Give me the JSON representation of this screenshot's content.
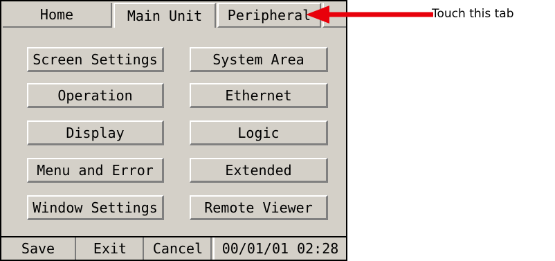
{
  "tabs": [
    {
      "label": "Home"
    },
    {
      "label": "Main Unit"
    },
    {
      "label": "Peripheral"
    }
  ],
  "menu": {
    "left": [
      {
        "label": "Screen Settings"
      },
      {
        "label": "Operation"
      },
      {
        "label": "Display"
      },
      {
        "label": "Menu and Error"
      },
      {
        "label": "Window Settings"
      }
    ],
    "right": [
      {
        "label": "System Area"
      },
      {
        "label": "Ethernet"
      },
      {
        "label": "Logic"
      },
      {
        "label": "Extended"
      },
      {
        "label": "Remote Viewer"
      }
    ]
  },
  "bottom_bar": {
    "save": "Save",
    "exit": "Exit",
    "cancel": "Cancel",
    "datetime": "00/01/01 02:28"
  },
  "annotation": {
    "text": "Touch this tab",
    "arrow_color": "#e8000b"
  },
  "colors": {
    "panel_bg": "#d4d0c8"
  }
}
